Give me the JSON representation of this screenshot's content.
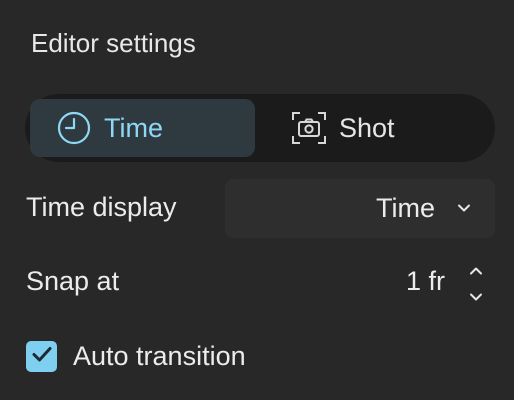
{
  "panel": {
    "title": "Editor settings"
  },
  "mode_toggle": {
    "options": [
      {
        "label": "Time",
        "icon": "clock-icon",
        "selected": true
      },
      {
        "label": "Shot",
        "icon": "camera-icon",
        "selected": false
      }
    ]
  },
  "time_display": {
    "label": "Time display",
    "selected_value": "Time"
  },
  "snap_at": {
    "label": "Snap at",
    "value": "1 fr"
  },
  "auto_transition": {
    "label": "Auto transition",
    "checked": true
  },
  "colors": {
    "background": "#282828",
    "accent": "#8fd8f5",
    "selected_segment": "#2f3a40",
    "segment_track": "#1b1b1b",
    "checkbox_fill": "#7fcff0"
  }
}
